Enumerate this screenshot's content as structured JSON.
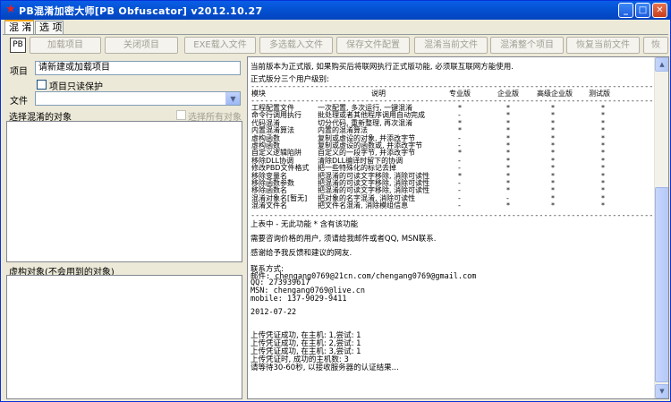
{
  "window": {
    "title": "PB混淆加密大师[PB Obfuscator] v2012.10.27",
    "minimize": "_",
    "maximize": "□",
    "close": "✕"
  },
  "tabs": [
    "混 淆",
    "选 项"
  ],
  "toolbar": {
    "icon_label": "PB",
    "buttons": [
      "加载项目",
      "关闭项目",
      "EXE载入文件",
      "多选载入文件",
      "保存文件配置",
      "混淆当前文件",
      "混淆整个项目",
      "恢复当前文件",
      "恢"
    ]
  },
  "left": {
    "project_label": "项目",
    "project_value": "请新建或加载项目",
    "readonly_label": "项目只读保护",
    "file_label": "文件",
    "file_value": "",
    "obj_label": "选择混淆的对象",
    "select_all_label": "选择所有对象",
    "virtual_label": "虚构对象(不会用到的对象)"
  },
  "right": {
    "intro1": "当前版本为正式版, 如果购买后将联网执行正式版功能, 必须联互联网方能使用.",
    "intro2": "正式版分三个用户级别:",
    "separator": "----------------------------------------------------------------------------------------",
    "table_header": [
      "模块",
      "说明",
      "专业版",
      "企业版",
      "高级企业版",
      "测试版"
    ],
    "table_rows": [
      [
        "工程配置文件",
        "一次配置, 多次运行, 一键混淆",
        "*",
        "*",
        "*",
        "*"
      ],
      [
        "命令行调用执行",
        "批处理或者其他程序调用自动完成",
        "-",
        "*",
        "*",
        "*"
      ],
      [
        "代码混淆",
        "切分代码, 重新整理, 再次混淆",
        "*",
        "*",
        "*",
        "*"
      ],
      [
        "内置混淆算法",
        "内置的混淆算法",
        "*",
        "*",
        "*",
        "*"
      ],
      [
        "虚构函数",
        "复制或虚设的对象, 并添改字节",
        "-",
        "*",
        "*",
        "*"
      ],
      [
        "虚构函数",
        "复制或虚设的函数或, 并添改字节",
        "-",
        "*",
        "*",
        "*"
      ],
      [
        "自定义逻辑陷阱",
        "自定义的一段字节, 并添改字节",
        "*",
        "*",
        "*",
        "*"
      ],
      [
        "移除DLL协调",
        "清除DLL编译时留下的协调",
        "-",
        "*",
        "*",
        "*"
      ],
      [
        "修改PBD文件格式",
        "把一些特殊化的标记去掉",
        "-",
        "*",
        "*",
        "*"
      ],
      [
        "移除变量名",
        "把混淆的可读文字移除, 消除可读性",
        "*",
        "*",
        "*",
        "*"
      ],
      [
        "移除函数参数",
        "把混淆的可读文字移除, 消除可读性",
        "-",
        "*",
        "*",
        "*"
      ],
      [
        "移除函数名",
        "把混淆的可读文字移除, 消除可读性",
        "-",
        "*",
        "*",
        "*"
      ],
      [
        "混淆对象名[暂无]",
        "把对象的名字混淆, 消除可读性",
        "-",
        "-",
        "*",
        "*"
      ],
      [
        "混淆文件名",
        "把文件名混淆, 消除模组信息",
        "-",
        "*",
        "*",
        "*"
      ]
    ],
    "legend": "上表中 - 无此功能 * 含有该功能",
    "contact1": "需要咨询价格的用户, 须请给我邮件或者QQ, MSN联系.",
    "contact2": "感谢给予我反馈和建议的网友.",
    "contact_title": "联系方式:",
    "email": "邮件: chengang0769@21cn.com/chengang0769@gmail.com",
    "qq": "QQ: 273939617",
    "msn": "MSN: chengang0769@live.cn",
    "mobile": "mobile: 137-9029-9411",
    "date": "2012-07-22",
    "log": [
      "上传凭证成功, 在主机: 1,尝试: 1",
      "上传凭证成功, 在主机: 2,尝试: 1",
      "上传凭证成功, 在主机: 3,尝试: 1",
      "上传凭证时, 成功的主机数: 3",
      "请等待30-60秒, 以接收服务器的认证结果..."
    ]
  }
}
